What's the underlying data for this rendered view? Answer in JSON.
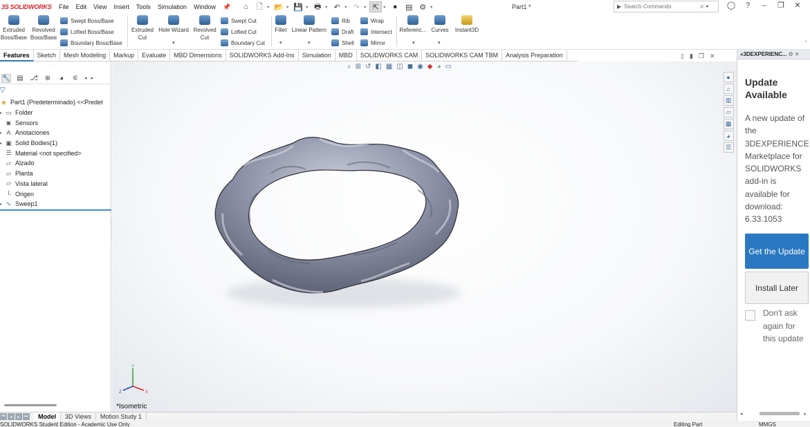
{
  "app": {
    "brand": "SOLIDWORKS",
    "brand_mark": "3S",
    "document_title": "Part1 *"
  },
  "menu": [
    "File",
    "Edit",
    "View",
    "Insert",
    "Tools",
    "Simulation",
    "Window"
  ],
  "search": {
    "placeholder": "Search Commands"
  },
  "commands": {
    "extruded_boss": "Extruded Boss/Base",
    "revolved_boss": "Revolved Boss/Base",
    "swept_boss": "Swept Boss/Base",
    "lofted_boss": "Lofted Boss/Base",
    "boundary_boss": "Boundary Boss/Base",
    "extruded_cut": "Extruded Cut",
    "hole_wizard": "Hole Wizard",
    "revolved_cut": "Revolved Cut",
    "swept_cut": "Swept Cut",
    "lofted_cut": "Lofted Cut",
    "boundary_cut": "Boundary Cut",
    "fillet": "Fillet",
    "linear_pattern": "Linear Pattern",
    "rib": "Rib",
    "draft": "Draft",
    "shell": "Shell",
    "wrap": "Wrap",
    "intersect": "Intersect",
    "mirror": "Mirror",
    "reference": "Referenc...",
    "curves": "Curves",
    "instant3d": "Instant3D"
  },
  "tabs": [
    "Features",
    "Sketch",
    "Mesh Modeling",
    "Markup",
    "Evaluate",
    "MBD Dimensions",
    "SOLIDWORKS Add-Ins",
    "Simulation",
    "MBD",
    "SOLIDWORKS CAM",
    "SOLIDWORKS CAM TBM",
    "Analysis Preparation"
  ],
  "tree": {
    "root": "Part1 (Predeterminado) <<Predet",
    "items": [
      "Folder",
      "Sensors",
      "Anotaciones",
      "Solid Bodies(1)",
      "Material <not specified>",
      "Alzado",
      "Planta",
      "Vista lateral",
      "Origen",
      "Sweep1"
    ]
  },
  "viewport": {
    "view_label": "*Isometric",
    "axis_x": "X",
    "axis_y": "Y",
    "axis_z": "Z"
  },
  "panel": {
    "header": "3DEXPERIENC...",
    "title": "Update Available",
    "body": "A new update of the 3DEXPERIENCE Marketplace for SOLIDWORKS add-in is available for download: 6.33.1053",
    "primary_button": "Get the Update",
    "secondary_button": "Install Later",
    "checkbox_label": "Don't ask again for this update",
    "accent_color": "#2b78c2"
  },
  "bottom_tabs": [
    "Model",
    "3D Views",
    "Motion Study 1"
  ],
  "status": {
    "left": "SOLIDWORKS Student Edition - Academic Use Only",
    "mode": "Editing Part",
    "units": "MMGS"
  }
}
